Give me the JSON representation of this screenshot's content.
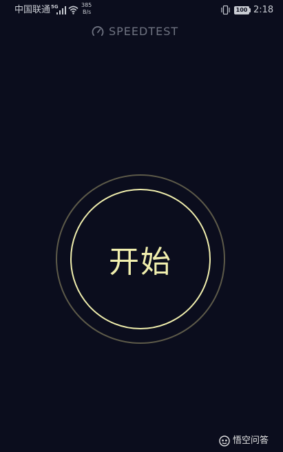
{
  "status_bar": {
    "carrier": "中国联通",
    "network_type": "5G",
    "speed_value": "385",
    "speed_unit": "B/s",
    "battery_level": "100",
    "time": "2:18",
    "icons": [
      "signal-icon",
      "wifi-icon",
      "vibrate-icon",
      "battery-icon"
    ]
  },
  "header": {
    "title": "SPEEDTEST",
    "logo_icon": "speedometer-icon"
  },
  "main": {
    "start_label": "开始"
  },
  "watermark": {
    "text": "悟空问答",
    "icon": "wukong-logo"
  },
  "colors": {
    "background": "#0b0d1d",
    "accent": "#f1efae",
    "outer_ring": "#5d5a49",
    "title": "#6f7381",
    "status_text": "#c9ccd3"
  }
}
